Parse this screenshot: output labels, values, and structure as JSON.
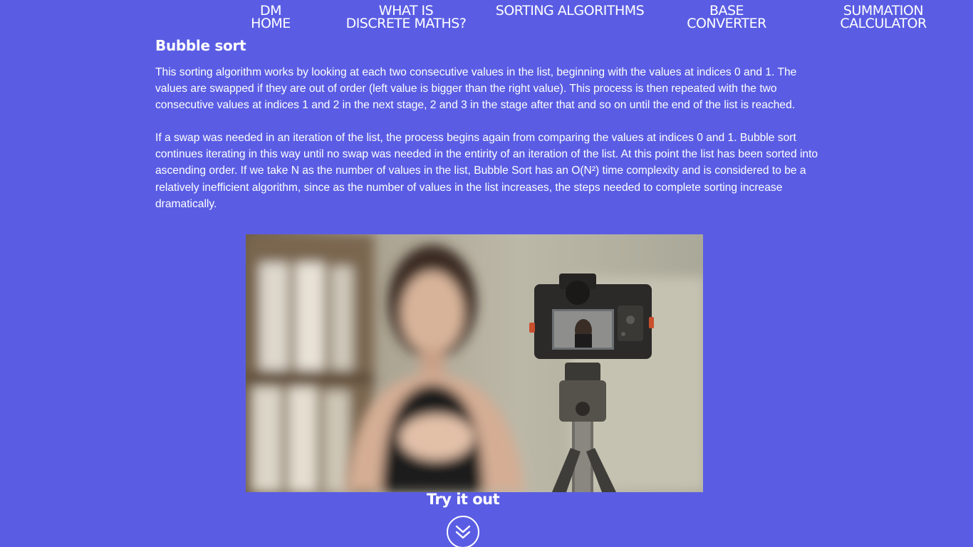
{
  "nav": {
    "home": [
      "DM",
      "HOME"
    ],
    "what_is": [
      "WHAT IS",
      "DISCRETE MATHS?"
    ],
    "sorting": [
      "SORTING ALGORITHMS"
    ],
    "base": [
      "BASE",
      "CONVERTER"
    ],
    "summation": [
      "SUMMATION",
      "CALCULATOR"
    ]
  },
  "section": {
    "title": "Bubble sort",
    "paragraphs": [
      "This sorting algorithm works by looking at each two consecutive values in the list, beginning with the values at indices 0 and 1. The values are swapped if they are out of order (left value is bigger than the right value). This process is then repeated with the two consecutive values at indices 1 and 2 in the next stage, 2 and 3 in the stage after that and so on until the end of the list is reached.",
      "If a swap was needed in an iteration of the list, the process begins again from comparing the values at indices 0 and 1. Bubble sort continues iterating in this way until no swap was needed in the entirity of an iteration of the list. At this point the list has been sorted into ascending order. If we take N as the number of values in the list, Bubble Sort has an O(N²) time complexity and is considered to be a relatively inefficient algorithm, since as the number of values in the list increases, the steps needed to complete sorting increase dramatically."
    ]
  },
  "media": {
    "icon": "video-photo"
  },
  "try_it": {
    "title": "Try it out",
    "icon": "double-chevron-down-icon"
  },
  "colors": {
    "background": "#5a5de3",
    "text": "#ffffff"
  }
}
